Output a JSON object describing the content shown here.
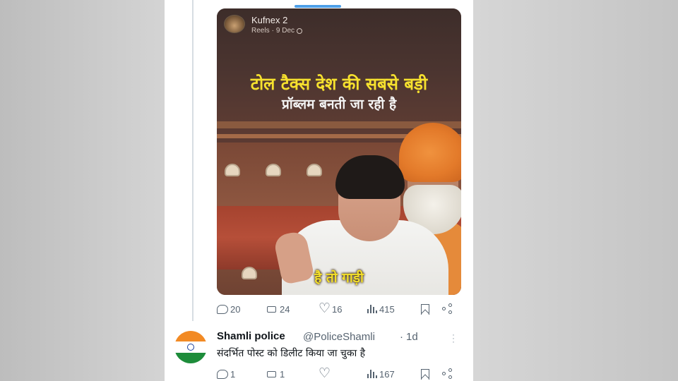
{
  "quoted_post": {
    "author": "Kufnex 2",
    "type": "Reels",
    "date": "9 Dec",
    "caption_line1": "टोल टैक्स देश की सबसे बड़ी",
    "caption_line2": "प्रॉब्लम बनती जा रही है",
    "subtitle": "है तो गाड़ी"
  },
  "post_actions": {
    "replies": "20",
    "reposts": "24",
    "likes": "16",
    "views": "415"
  },
  "reply": {
    "name": "Shamli police",
    "handle": "@PoliceShamli",
    "separator": "·",
    "time": "1d",
    "text": "संदर्भित पोस्ट को डिलीट किया जा चुका है",
    "actions": {
      "replies": "1",
      "reposts": "1",
      "likes": "",
      "views": "167"
    }
  },
  "icons": [
    "reply-icon",
    "repost-icon",
    "heart-icon",
    "views-icon",
    "bookmark-icon",
    "share-icon",
    "more-icon",
    "globe-icon"
  ],
  "colors": {
    "caption_yellow": "#f6e12e",
    "muted_text": "#566370",
    "scroll_indicator": "#4d9fe8"
  }
}
